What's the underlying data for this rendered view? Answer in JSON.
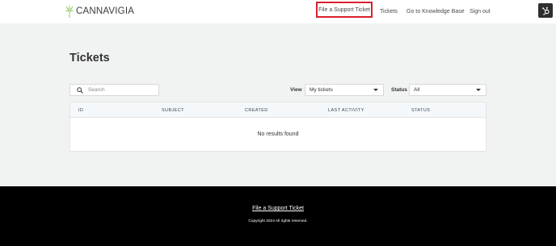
{
  "brand": {
    "name": "CANNAVIGIA",
    "leaf_color": "#7bbf3a"
  },
  "nav": {
    "file_ticket": "File a Support Ticket",
    "tickets": "Tickets",
    "knowledge_base": "Go to Knowledge Base",
    "sign_out": "Sign out"
  },
  "page": {
    "title": "Tickets"
  },
  "search": {
    "placeholder": "Search"
  },
  "filters": {
    "view_label": "View",
    "view_value": "My tickets",
    "status_label": "Status",
    "status_value": "All"
  },
  "table": {
    "columns": [
      "ID",
      "SUBJECT",
      "CREATED",
      "LAST ACTIVITY",
      "STATUS"
    ],
    "empty_message": "No results found"
  },
  "footer": {
    "link": "File a Support Ticket",
    "copyright": "Copyright 2024 All rights reserved."
  },
  "colors": {
    "highlight": "#d6212f",
    "footer_bg": "#000000",
    "page_bg": "#f1f2f2"
  }
}
